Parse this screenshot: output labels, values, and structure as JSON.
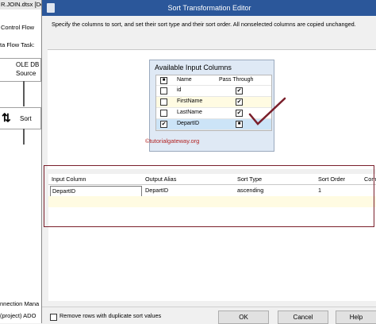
{
  "background": {
    "file_tab": "R.JOIN.dtsx [Des",
    "control_flow_tab": "Control Flow",
    "data_flow_task_label": "ta Flow Task:",
    "ole_db_source_line1": "OLE DB",
    "ole_db_source_line2": "Source",
    "sort_label": "Sort",
    "connection_manager": "nnection Mana",
    "project_connection": "(project) ADO"
  },
  "dialog": {
    "title": "Sort Transformation Editor",
    "instructions": "Specify the columns to sort, and set their sort type and their sort order. All nonselected columns are copied unchanged.",
    "available_columns": {
      "title": "Available Input Columns",
      "header_name": "Name",
      "header_pass_through": "Pass Through",
      "rows": [
        {
          "name": "id",
          "selected": false,
          "pass_through": true
        },
        {
          "name": "FirstName",
          "selected": false,
          "pass_through": true
        },
        {
          "name": "LastName",
          "selected": false,
          "pass_through": true
        },
        {
          "name": "DepartID",
          "selected": true,
          "pass_through": true
        }
      ],
      "check_glyph": "✔",
      "square_glyph": "■"
    },
    "watermark": "©tutorialgateway.org",
    "grid": {
      "headers": [
        "Input Column",
        "Output Alias",
        "Sort Type",
        "Sort Order",
        "Com"
      ],
      "rows": [
        {
          "input_column": "DepartID",
          "output_alias": "DepartID",
          "sort_type": "ascending",
          "sort_order": "1",
          "comparison": ""
        }
      ]
    },
    "remove_duplicates_label": "Remove rows with duplicate sort values",
    "buttons": {
      "ok": "OK",
      "cancel": "Cancel",
      "help": "Help"
    }
  },
  "colors": {
    "title_bar": "#2b579a",
    "annotation_red": "#7a1f2b",
    "highlight_row": "#fffbe2"
  }
}
